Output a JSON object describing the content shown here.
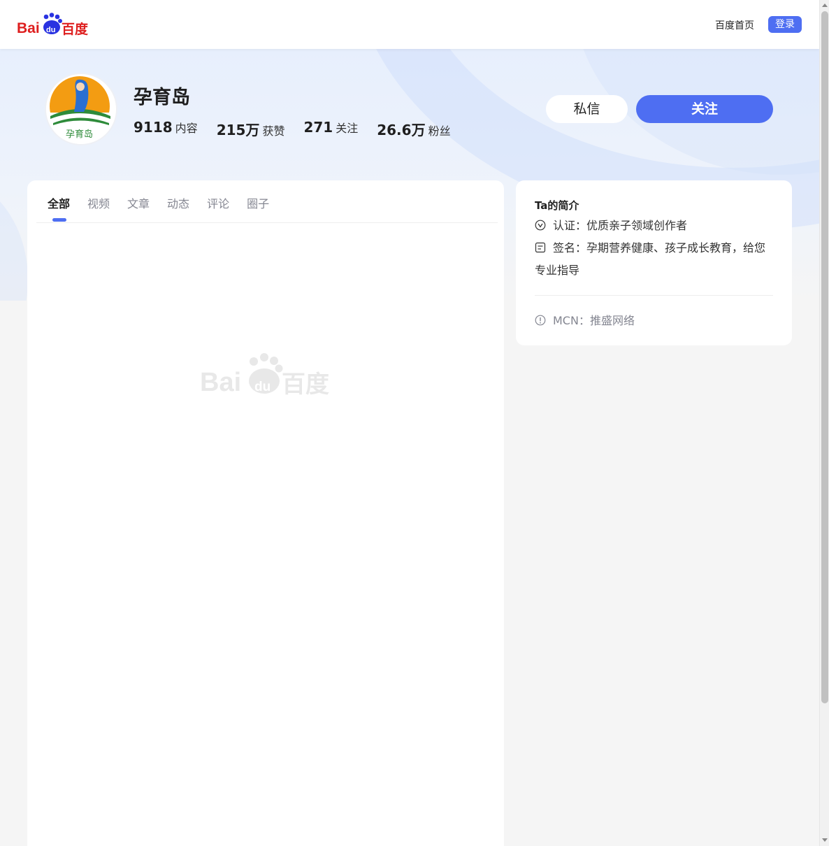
{
  "nav": {
    "logo_text": "Bai du 百度",
    "home_link": "百度首页",
    "login_button": "登录"
  },
  "profile": {
    "name": "孕育岛",
    "avatar_text": "孕育岛",
    "stats": [
      {
        "value": "9118",
        "label": "内容"
      },
      {
        "value": "215万",
        "label": "获赞"
      },
      {
        "value": "271",
        "label": "关注"
      },
      {
        "value": "26.6万",
        "label": "粉丝"
      }
    ],
    "message_button": "私信",
    "follow_button": "关注"
  },
  "tabs": [
    {
      "label": "全部",
      "active": true
    },
    {
      "label": "视频",
      "active": false
    },
    {
      "label": "文章",
      "active": false
    },
    {
      "label": "动态",
      "active": false
    },
    {
      "label": "评论",
      "active": false
    },
    {
      "label": "圈子",
      "active": false
    }
  ],
  "placeholder_logo_text": "Bai du 百度",
  "intro": {
    "title": "Ta的简介",
    "certification": "认证：优质亲子领域创作者",
    "signature": "签名：孕期营养健康、孩子成长教育，给您专业指导",
    "mcn": "MCN：推盛网络"
  },
  "colors": {
    "accent": "#4e6ef2",
    "brand_red": "#de1f1f",
    "brand_blue": "#2932e1"
  },
  "icons": [
    "baidu-logo",
    "verified-icon",
    "note-icon",
    "info-icon"
  ]
}
